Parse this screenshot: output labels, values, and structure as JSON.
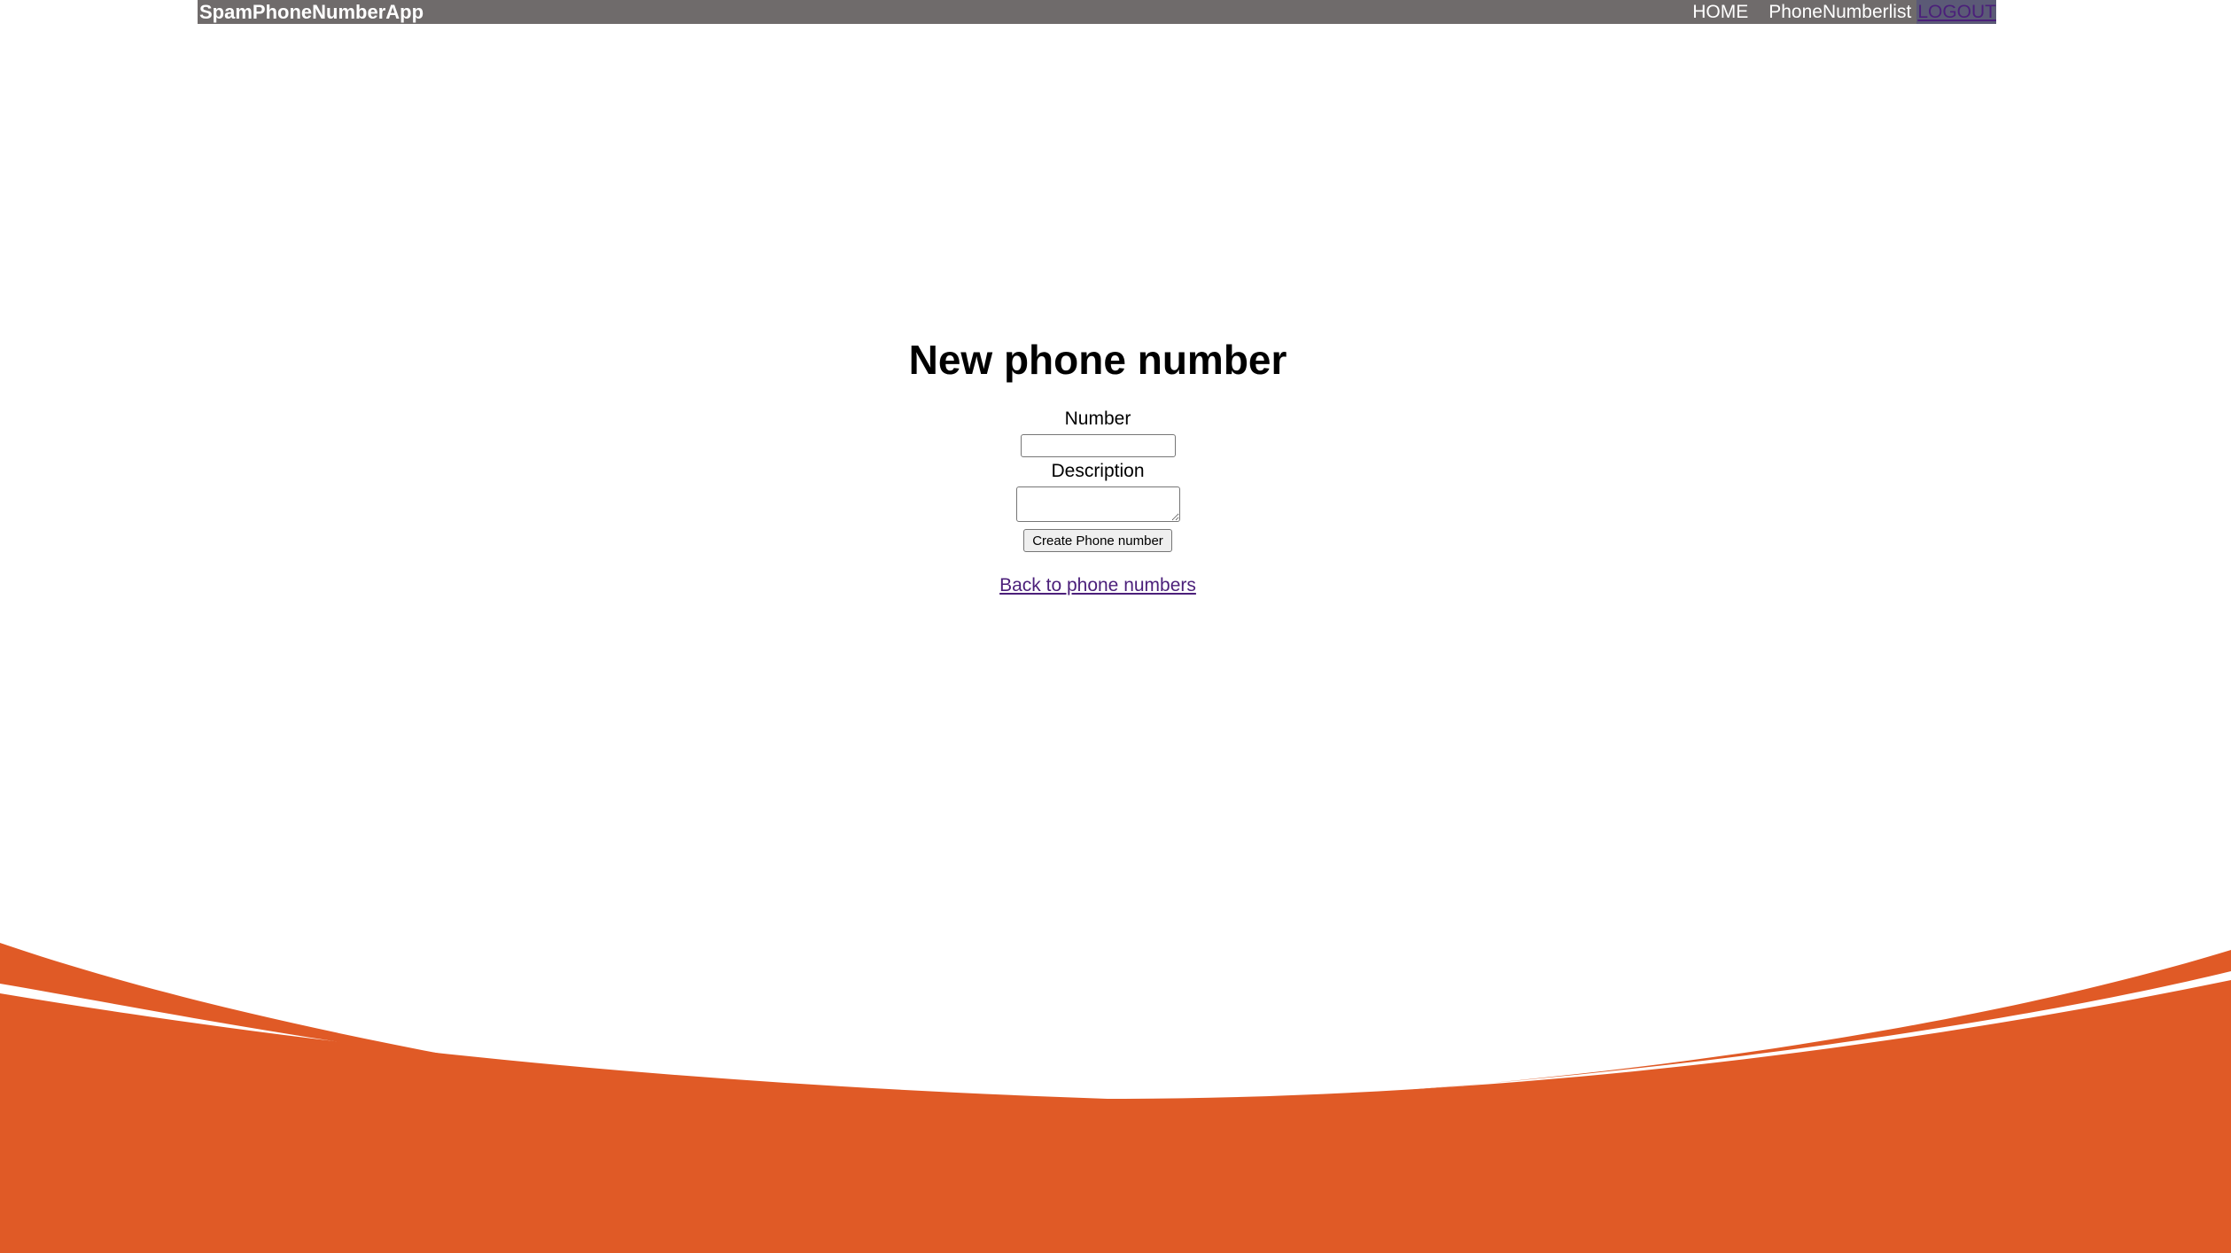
{
  "nav": {
    "brand": "SpamPhoneNumberApp",
    "home": "HOME",
    "list": "PhoneNumberlist",
    "logout": "LOGOUT"
  },
  "main": {
    "title": "New phone number",
    "number_label": "Number",
    "number_value": "",
    "description_label": "Description",
    "description_value": "",
    "submit_label": "Create Phone number",
    "back_link": "Back to phone numbers"
  },
  "colors": {
    "navbar": "#6f6b6b",
    "accent": "#e05a26",
    "link": "#4b1f7a"
  }
}
